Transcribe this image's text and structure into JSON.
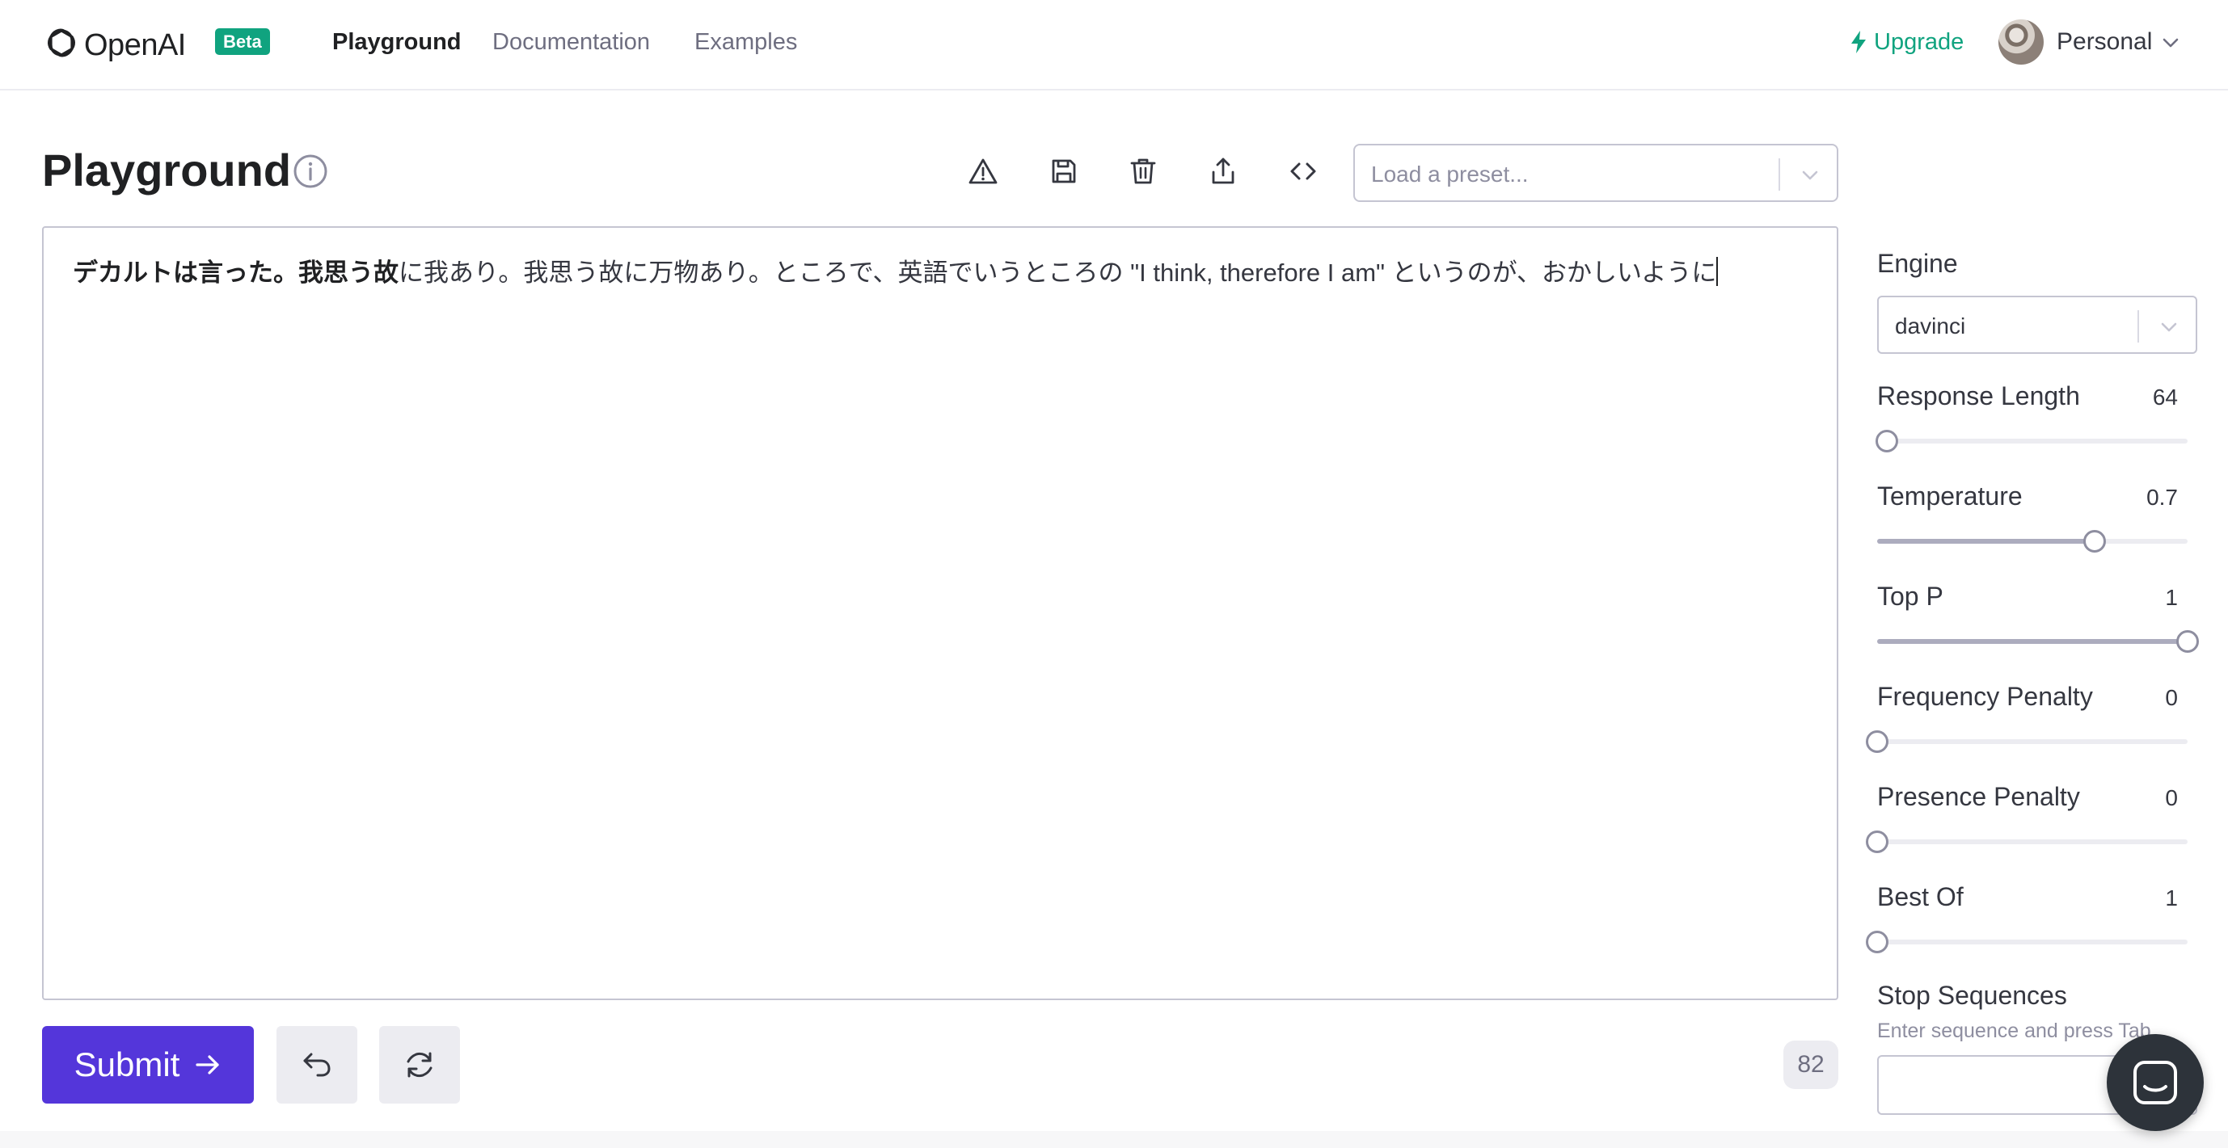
{
  "app": {
    "brand_name": "OpenAI",
    "beta_badge": "Beta",
    "accent_color": "#10a37f",
    "primary_button_color": "#5436da"
  },
  "nav": {
    "links": [
      "Playground",
      "Documentation",
      "Examples"
    ],
    "active": "Playground",
    "upgrade_label": "Upgrade",
    "account_label": "Personal"
  },
  "header": {
    "title": "Playground",
    "toolbar_icons": [
      "warning-icon",
      "save-icon",
      "trash-icon",
      "share-icon",
      "code-icon"
    ],
    "preset_placeholder": "Load a preset..."
  },
  "editor": {
    "bold_text": "デカルトは言った。我思う故",
    "text": "に我あり。我思う故に万物あり。ところで、英語でいうところの \"I think, therefore I am\" というのが、おかしいように"
  },
  "actions": {
    "submit_label": "Submit",
    "token_count": "82"
  },
  "settings": {
    "engine_label": "Engine",
    "engine_value": "davinci",
    "sliders": [
      {
        "label": "Response Length",
        "value": "64",
        "fraction": 0.03
      },
      {
        "label": "Temperature",
        "value": "0.7",
        "fraction": 0.7
      },
      {
        "label": "Top P",
        "value": "1",
        "fraction": 1.0
      },
      {
        "label": "Frequency Penalty",
        "value": "0",
        "fraction": 0.0
      },
      {
        "label": "Presence Penalty",
        "value": "0",
        "fraction": 0.0
      },
      {
        "label": "Best Of",
        "value": "1",
        "fraction": 0.0
      }
    ],
    "stop_sequences_label": "Stop Sequences",
    "stop_sequences_hint": "Enter sequence and press Tab"
  }
}
